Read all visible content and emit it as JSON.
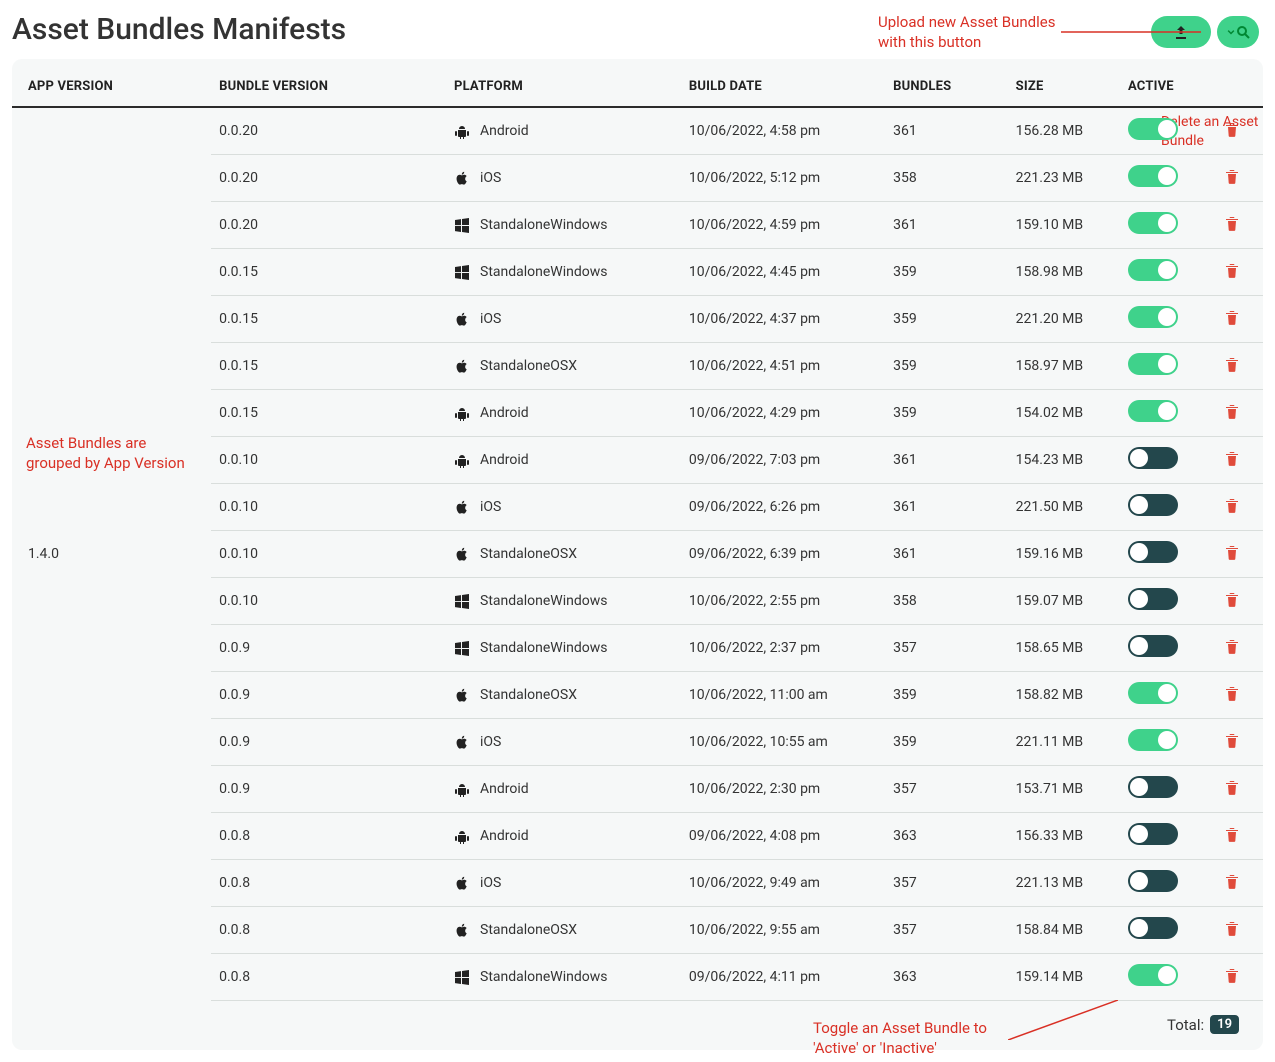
{
  "page": {
    "title": "Asset Bundles Manifests",
    "total_label": "Total:",
    "total_value": "19",
    "app_version_group": "1.4.0"
  },
  "annotations": {
    "upload": "Upload new Asset Bundles with this button",
    "delete": "Delete an Asset Bundle",
    "group": "Asset Bundles are grouped by App Version",
    "toggle": "Toggle an Asset Bundle to 'Active' or 'Inactive'"
  },
  "columns": {
    "app_version": "APP VERSION",
    "bundle_version": "BUNDLE VERSION",
    "platform": "PLATFORM",
    "build_date": "BUILD DATE",
    "bundles": "BUNDLES",
    "size": "SIZE",
    "active": "ACTIVE"
  },
  "rows": [
    {
      "bv": "0.0.20",
      "platform": "Android",
      "icon": "android",
      "date": "10/06/2022, 4:58 pm",
      "bundles": "361",
      "size": "156.28 MB",
      "active": true
    },
    {
      "bv": "0.0.20",
      "platform": "iOS",
      "icon": "apple",
      "date": "10/06/2022, 5:12 pm",
      "bundles": "358",
      "size": "221.23 MB",
      "active": true
    },
    {
      "bv": "0.0.20",
      "platform": "StandaloneWindows",
      "icon": "windows",
      "date": "10/06/2022, 4:59 pm",
      "bundles": "361",
      "size": "159.10 MB",
      "active": true
    },
    {
      "bv": "0.0.15",
      "platform": "StandaloneWindows",
      "icon": "windows",
      "date": "10/06/2022, 4:45 pm",
      "bundles": "359",
      "size": "158.98 MB",
      "active": true
    },
    {
      "bv": "0.0.15",
      "platform": "iOS",
      "icon": "apple",
      "date": "10/06/2022, 4:37 pm",
      "bundles": "359",
      "size": "221.20 MB",
      "active": true
    },
    {
      "bv": "0.0.15",
      "platform": "StandaloneOSX",
      "icon": "apple",
      "date": "10/06/2022, 4:51 pm",
      "bundles": "359",
      "size": "158.97 MB",
      "active": true
    },
    {
      "bv": "0.0.15",
      "platform": "Android",
      "icon": "android",
      "date": "10/06/2022, 4:29 pm",
      "bundles": "359",
      "size": "154.02 MB",
      "active": true
    },
    {
      "bv": "0.0.10",
      "platform": "Android",
      "icon": "android",
      "date": "09/06/2022, 7:03 pm",
      "bundles": "361",
      "size": "154.23 MB",
      "active": false
    },
    {
      "bv": "0.0.10",
      "platform": "iOS",
      "icon": "apple",
      "date": "09/06/2022, 6:26 pm",
      "bundles": "361",
      "size": "221.50 MB",
      "active": false
    },
    {
      "bv": "0.0.10",
      "platform": "StandaloneOSX",
      "icon": "apple",
      "date": "09/06/2022, 6:39 pm",
      "bundles": "361",
      "size": "159.16 MB",
      "active": false
    },
    {
      "bv": "0.0.10",
      "platform": "StandaloneWindows",
      "icon": "windows",
      "date": "10/06/2022, 2:55 pm",
      "bundles": "358",
      "size": "159.07 MB",
      "active": false
    },
    {
      "bv": "0.0.9",
      "platform": "StandaloneWindows",
      "icon": "windows",
      "date": "10/06/2022, 2:37 pm",
      "bundles": "357",
      "size": "158.65 MB",
      "active": false
    },
    {
      "bv": "0.0.9",
      "platform": "StandaloneOSX",
      "icon": "apple",
      "date": "10/06/2022, 11:00 am",
      "bundles": "359",
      "size": "158.82 MB",
      "active": true
    },
    {
      "bv": "0.0.9",
      "platform": "iOS",
      "icon": "apple",
      "date": "10/06/2022, 10:55 am",
      "bundles": "359",
      "size": "221.11 MB",
      "active": true
    },
    {
      "bv": "0.0.9",
      "platform": "Android",
      "icon": "android",
      "date": "10/06/2022, 2:30 pm",
      "bundles": "357",
      "size": "153.71 MB",
      "active": false
    },
    {
      "bv": "0.0.8",
      "platform": "Android",
      "icon": "android",
      "date": "09/06/2022, 4:08 pm",
      "bundles": "363",
      "size": "156.33 MB",
      "active": false
    },
    {
      "bv": "0.0.8",
      "platform": "iOS",
      "icon": "apple",
      "date": "10/06/2022, 9:49 am",
      "bundles": "357",
      "size": "221.13 MB",
      "active": false
    },
    {
      "bv": "0.0.8",
      "platform": "StandaloneOSX",
      "icon": "apple",
      "date": "10/06/2022, 9:55 am",
      "bundles": "357",
      "size": "158.84 MB",
      "active": false
    },
    {
      "bv": "0.0.8",
      "platform": "StandaloneWindows",
      "icon": "windows",
      "date": "09/06/2022, 4:11 pm",
      "bundles": "363",
      "size": "159.14 MB",
      "active": true
    }
  ]
}
